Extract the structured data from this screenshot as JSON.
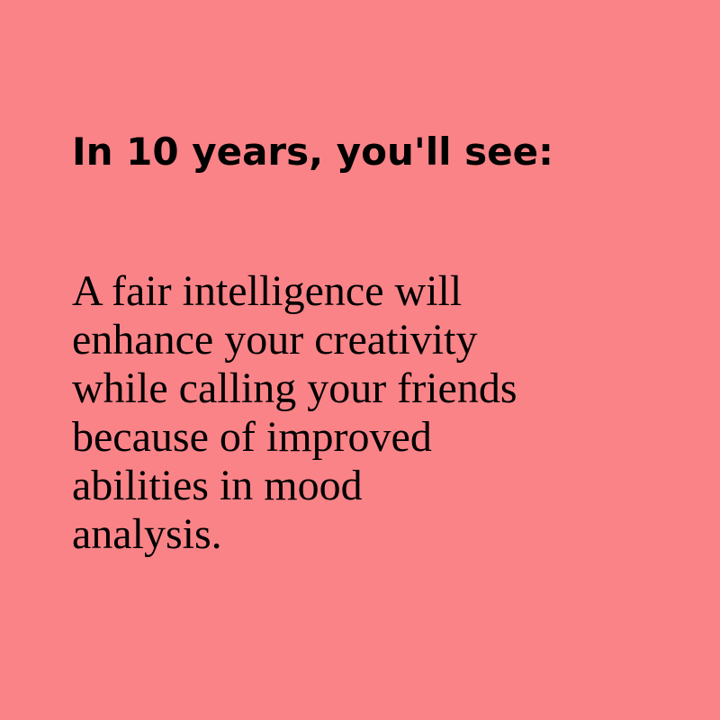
{
  "colors": {
    "background": "#FA8387",
    "text": "#000000"
  },
  "headline": "In 10 years, you'll see:",
  "body_lines": [
    "A fair intelligence will",
    "enhance your creativity",
    "while calling your friends",
    "because of improved",
    "abilities in mood",
    "analysis."
  ]
}
